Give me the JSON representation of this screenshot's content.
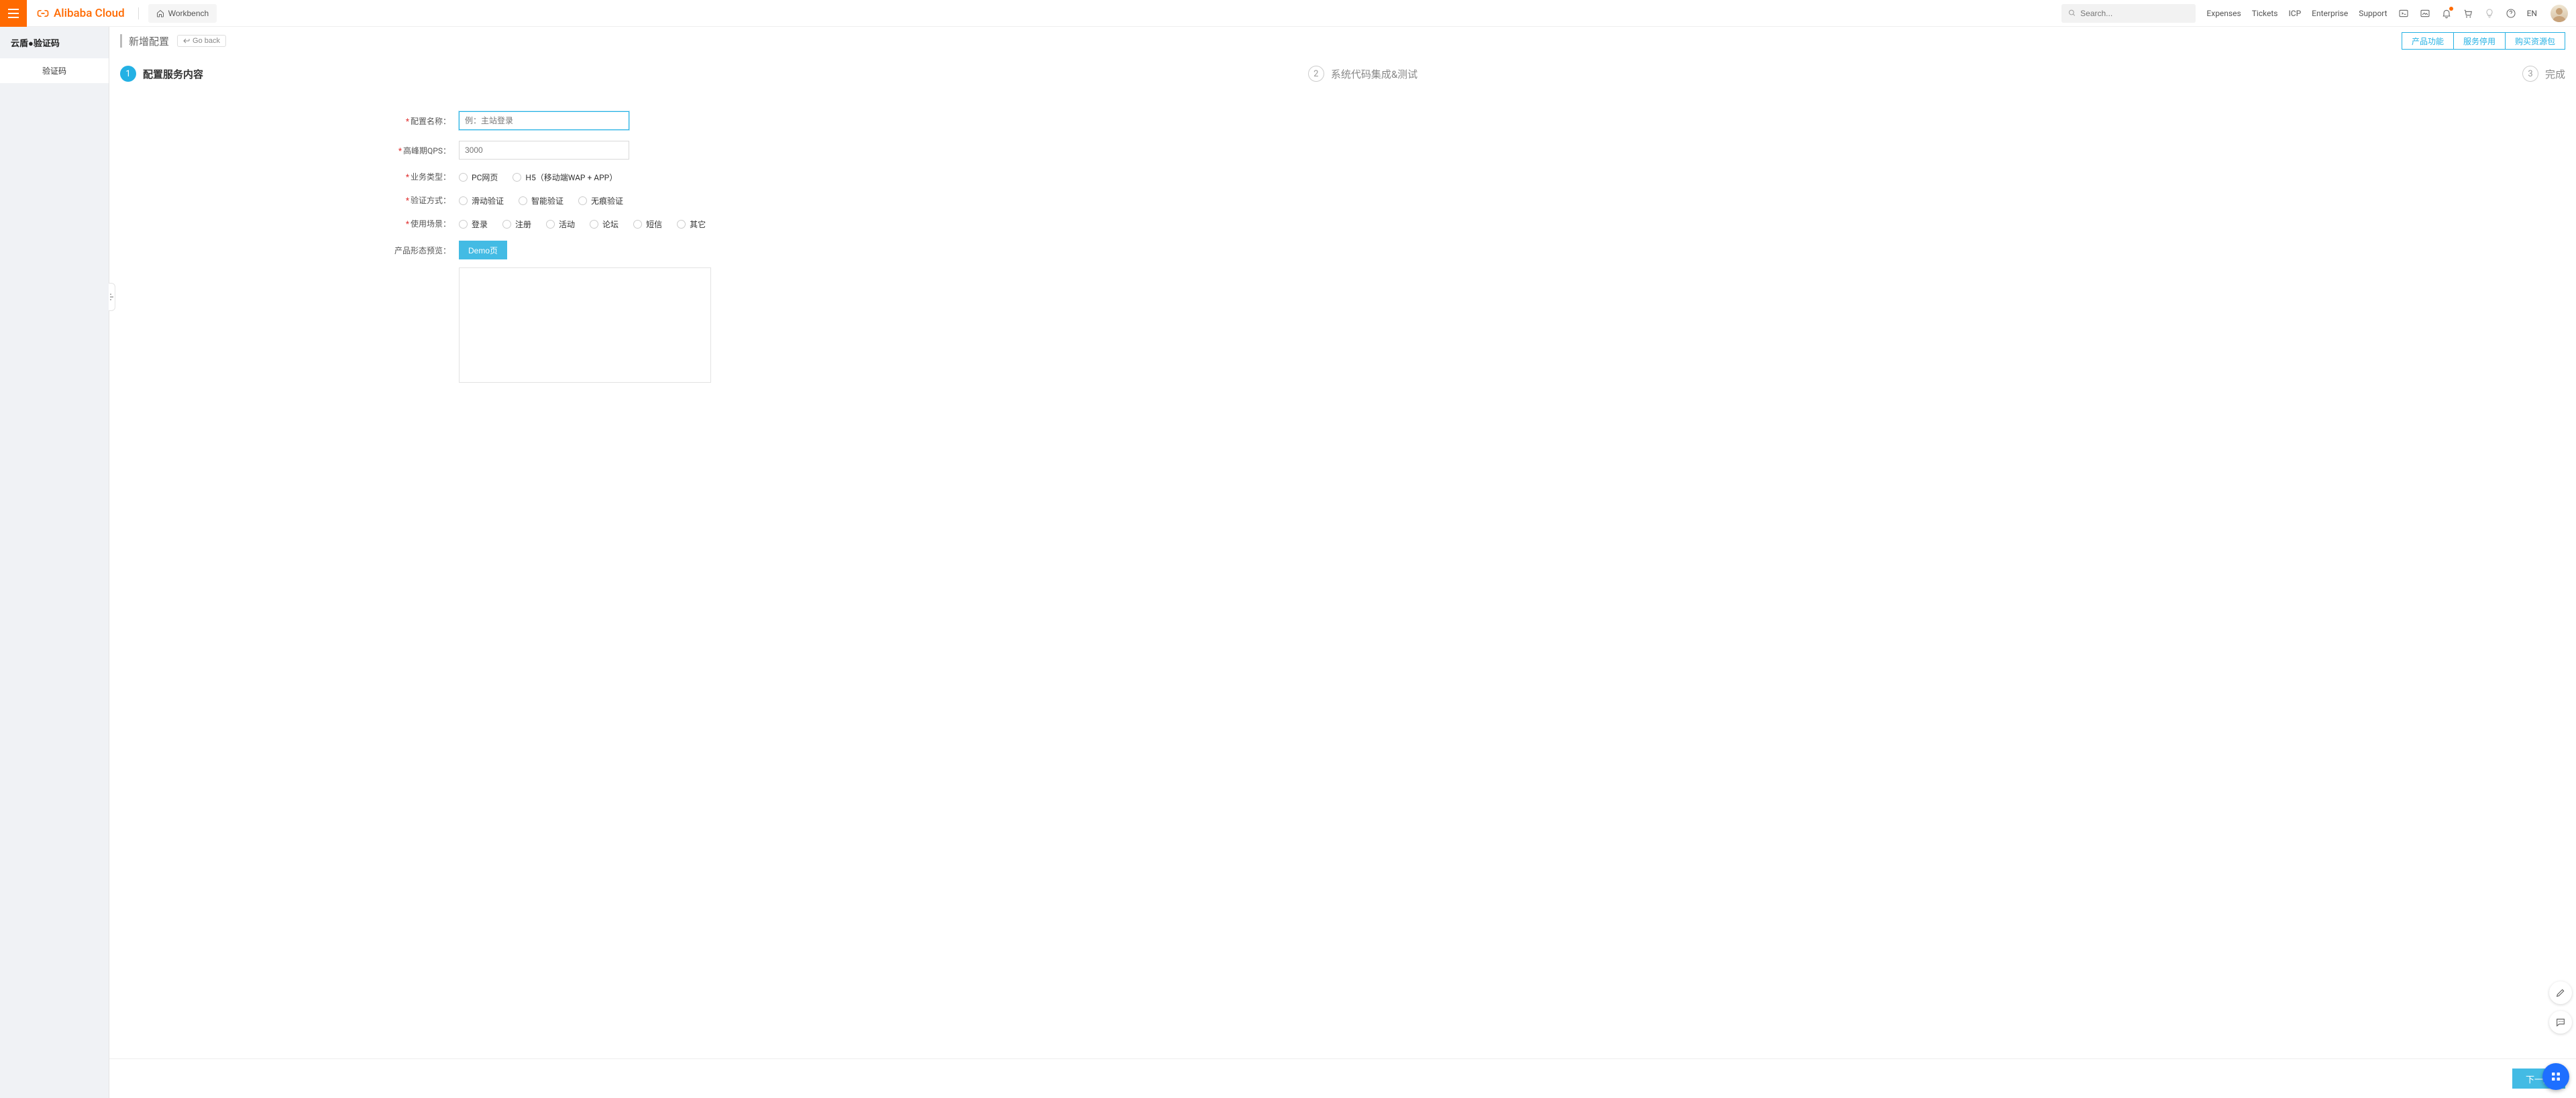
{
  "header": {
    "brand": "Alibaba Cloud",
    "workbench": "Workbench",
    "search_placeholder": "Search...",
    "nav": {
      "expenses": "Expenses",
      "tickets": "Tickets",
      "icp": "ICP",
      "enterprise": "Enterprise",
      "support": "Support"
    },
    "lang": "EN"
  },
  "sidebar": {
    "title": "云盾●验证码",
    "items": [
      {
        "label": "验证码"
      }
    ]
  },
  "page": {
    "title": "新增配置",
    "go_back": "Go back",
    "actions": {
      "features": "产品功能",
      "deprecate": "服务停用",
      "purchase": "购买资源包"
    }
  },
  "steps": [
    {
      "num": "1",
      "label": "配置服务内容"
    },
    {
      "num": "2",
      "label": "系统代码集成&测试"
    },
    {
      "num": "3",
      "label": "完成"
    }
  ],
  "form": {
    "config_name": {
      "label": "配置名称：",
      "placeholder": "例：主站登录",
      "value": ""
    },
    "peak_qps": {
      "label": "高峰期QPS：",
      "placeholder": "3000",
      "value": ""
    },
    "biz_type": {
      "label": "业务类型：",
      "options": [
        "PC网页",
        "H5（移动端WAP + APP）"
      ]
    },
    "verify_type": {
      "label": "验证方式：",
      "options": [
        "滑动验证",
        "智能验证",
        "无痕验证"
      ]
    },
    "scene": {
      "label": "使用场景：",
      "options": [
        "登录",
        "注册",
        "活动",
        "论坛",
        "短信",
        "其它"
      ]
    },
    "preview": {
      "label": "产品形态预览：",
      "demo_btn": "Demo页"
    }
  },
  "footer": {
    "next": "下一步"
  }
}
